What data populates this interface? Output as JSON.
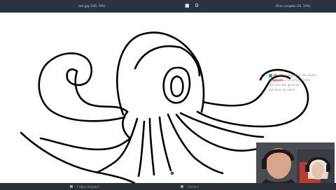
{
  "topbar": {
    "tab_left": "test.jpg (100, 74%)",
    "tab_right": "Ohne vorgabe (10, 10%)"
  },
  "drawing": {
    "subject": "octopus line drawing",
    "stroke_color": "#000000",
    "background_color": "#ffffff"
  },
  "chat": {
    "line1_user": "do",
    "line1_text": "ich so allgemein die einem",
    "line2_user": "mogipati...",
    "line2_text": "ich schon wieder",
    "line3_text": "dein ein rote ganz am",
    "line4_text": "gut wenn du einen"
  },
  "bottombar": {
    "label_left": "Folgen Angebot",
    "label_right": "Zeichne"
  }
}
